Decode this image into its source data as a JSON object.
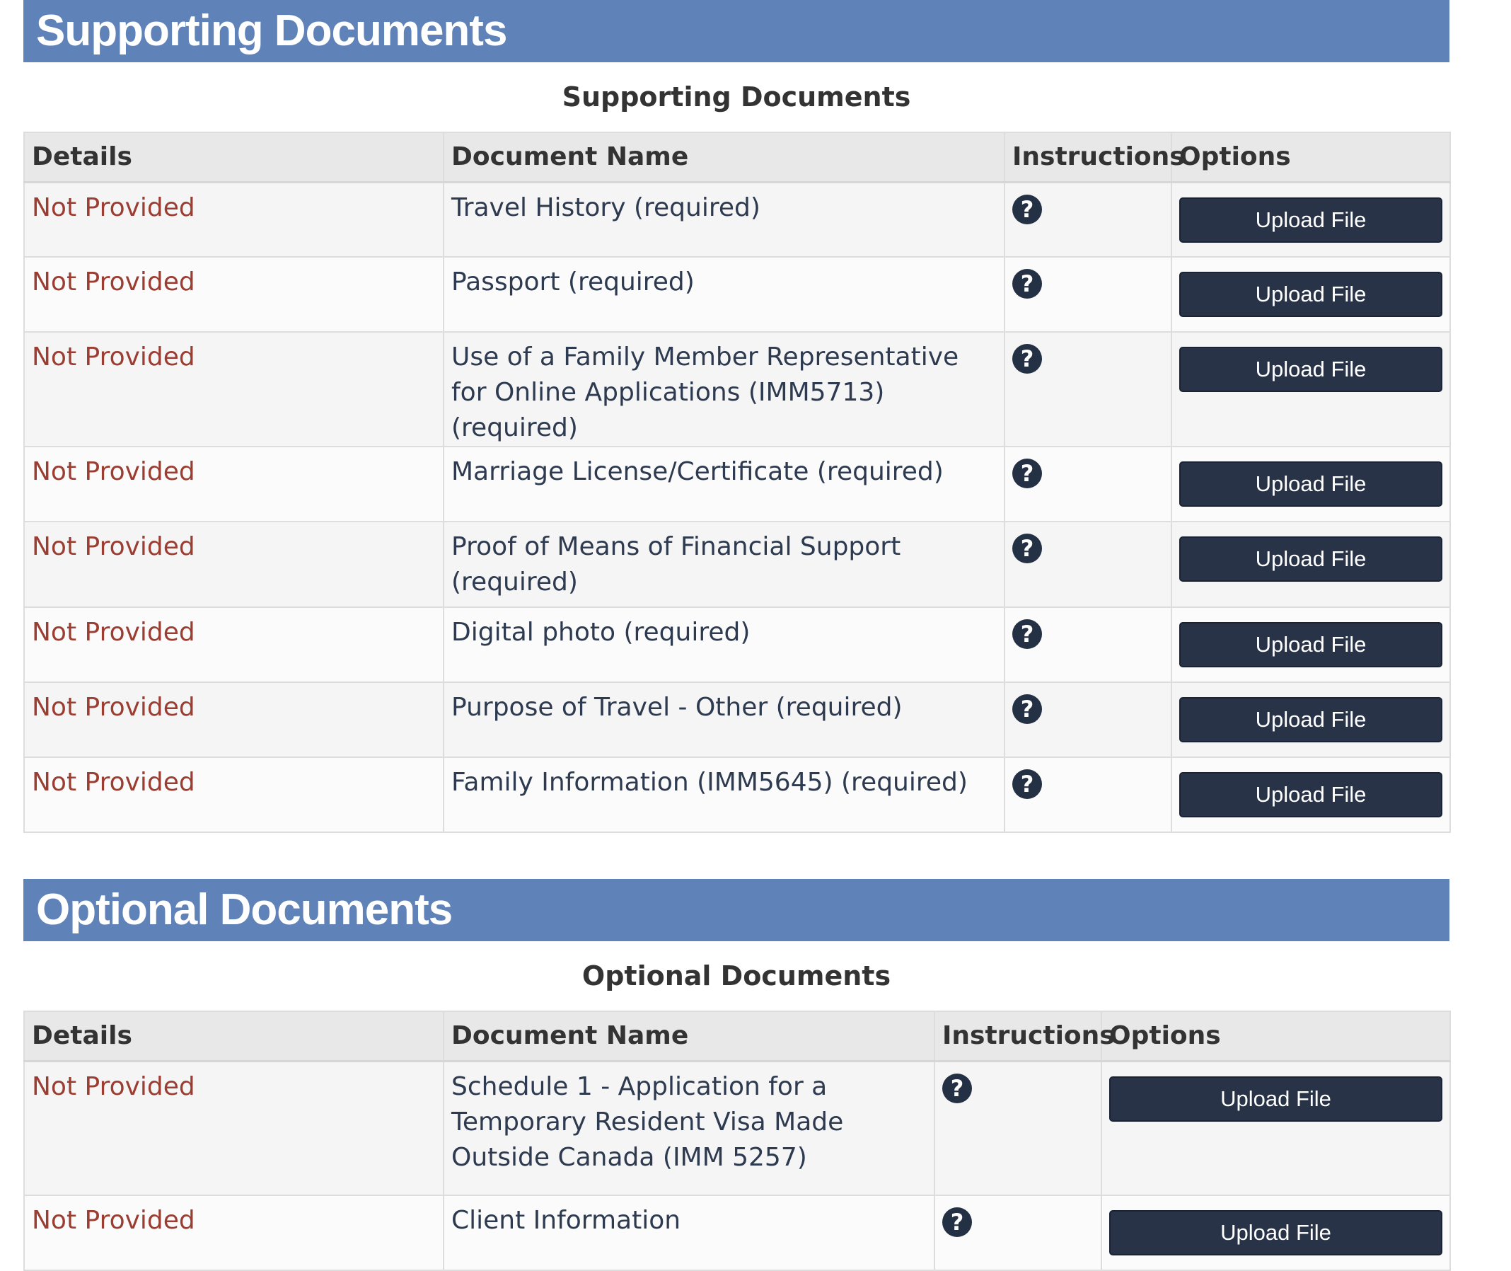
{
  "supporting": {
    "banner": "Supporting Documents",
    "caption": "Supporting Documents",
    "headers": {
      "details": "Details",
      "document_name": "Document Name",
      "instructions": "Instructions",
      "options": "Options"
    },
    "rows": [
      {
        "status": "Not Provided",
        "name": "Travel History  (required)",
        "icon": "question-circle-icon",
        "button": "Upload File"
      },
      {
        "status": "Not Provided",
        "name": "Passport  (required)",
        "icon": "question-circle-icon",
        "button": "Upload File"
      },
      {
        "status": "Not Provided",
        "name": "Use of a Family Member Representative for Online Applications (IMM5713)  (required)",
        "icon": "question-circle-icon",
        "button": "Upload File"
      },
      {
        "status": "Not Provided",
        "name": "Marriage License/Certificate  (required)",
        "icon": "question-circle-icon",
        "button": "Upload File"
      },
      {
        "status": "Not Provided",
        "name": "Proof of Means of Financial Support  (required)",
        "icon": "question-circle-icon",
        "button": "Upload File"
      },
      {
        "status": "Not Provided",
        "name": "Digital photo  (required)",
        "icon": "question-circle-icon",
        "button": "Upload File"
      },
      {
        "status": "Not Provided",
        "name": "Purpose of Travel - Other  (required)",
        "icon": "question-circle-icon",
        "button": "Upload File"
      },
      {
        "status": "Not Provided",
        "name": "Family Information (IMM5645)  (required)",
        "icon": "question-circle-icon",
        "button": "Upload File"
      }
    ]
  },
  "optional": {
    "banner": "Optional Documents",
    "caption": "Optional Documents",
    "headers": {
      "details": "Details",
      "document_name": "Document Name",
      "instructions": "Instructions",
      "options": "Options"
    },
    "rows": [
      {
        "status": "Not Provided",
        "name": "Schedule 1 - Application for a Temporary Resident Visa Made Outside Canada (IMM 5257)",
        "icon": "question-circle-icon",
        "button": "Upload File"
      },
      {
        "status": "Not Provided",
        "name": "Client Information",
        "icon": "question-circle-icon",
        "button": "Upload File"
      }
    ]
  },
  "colors": {
    "banner": "#5f82b8",
    "status_text": "#9c3d32",
    "button": "#283348",
    "icon": "#243044"
  }
}
